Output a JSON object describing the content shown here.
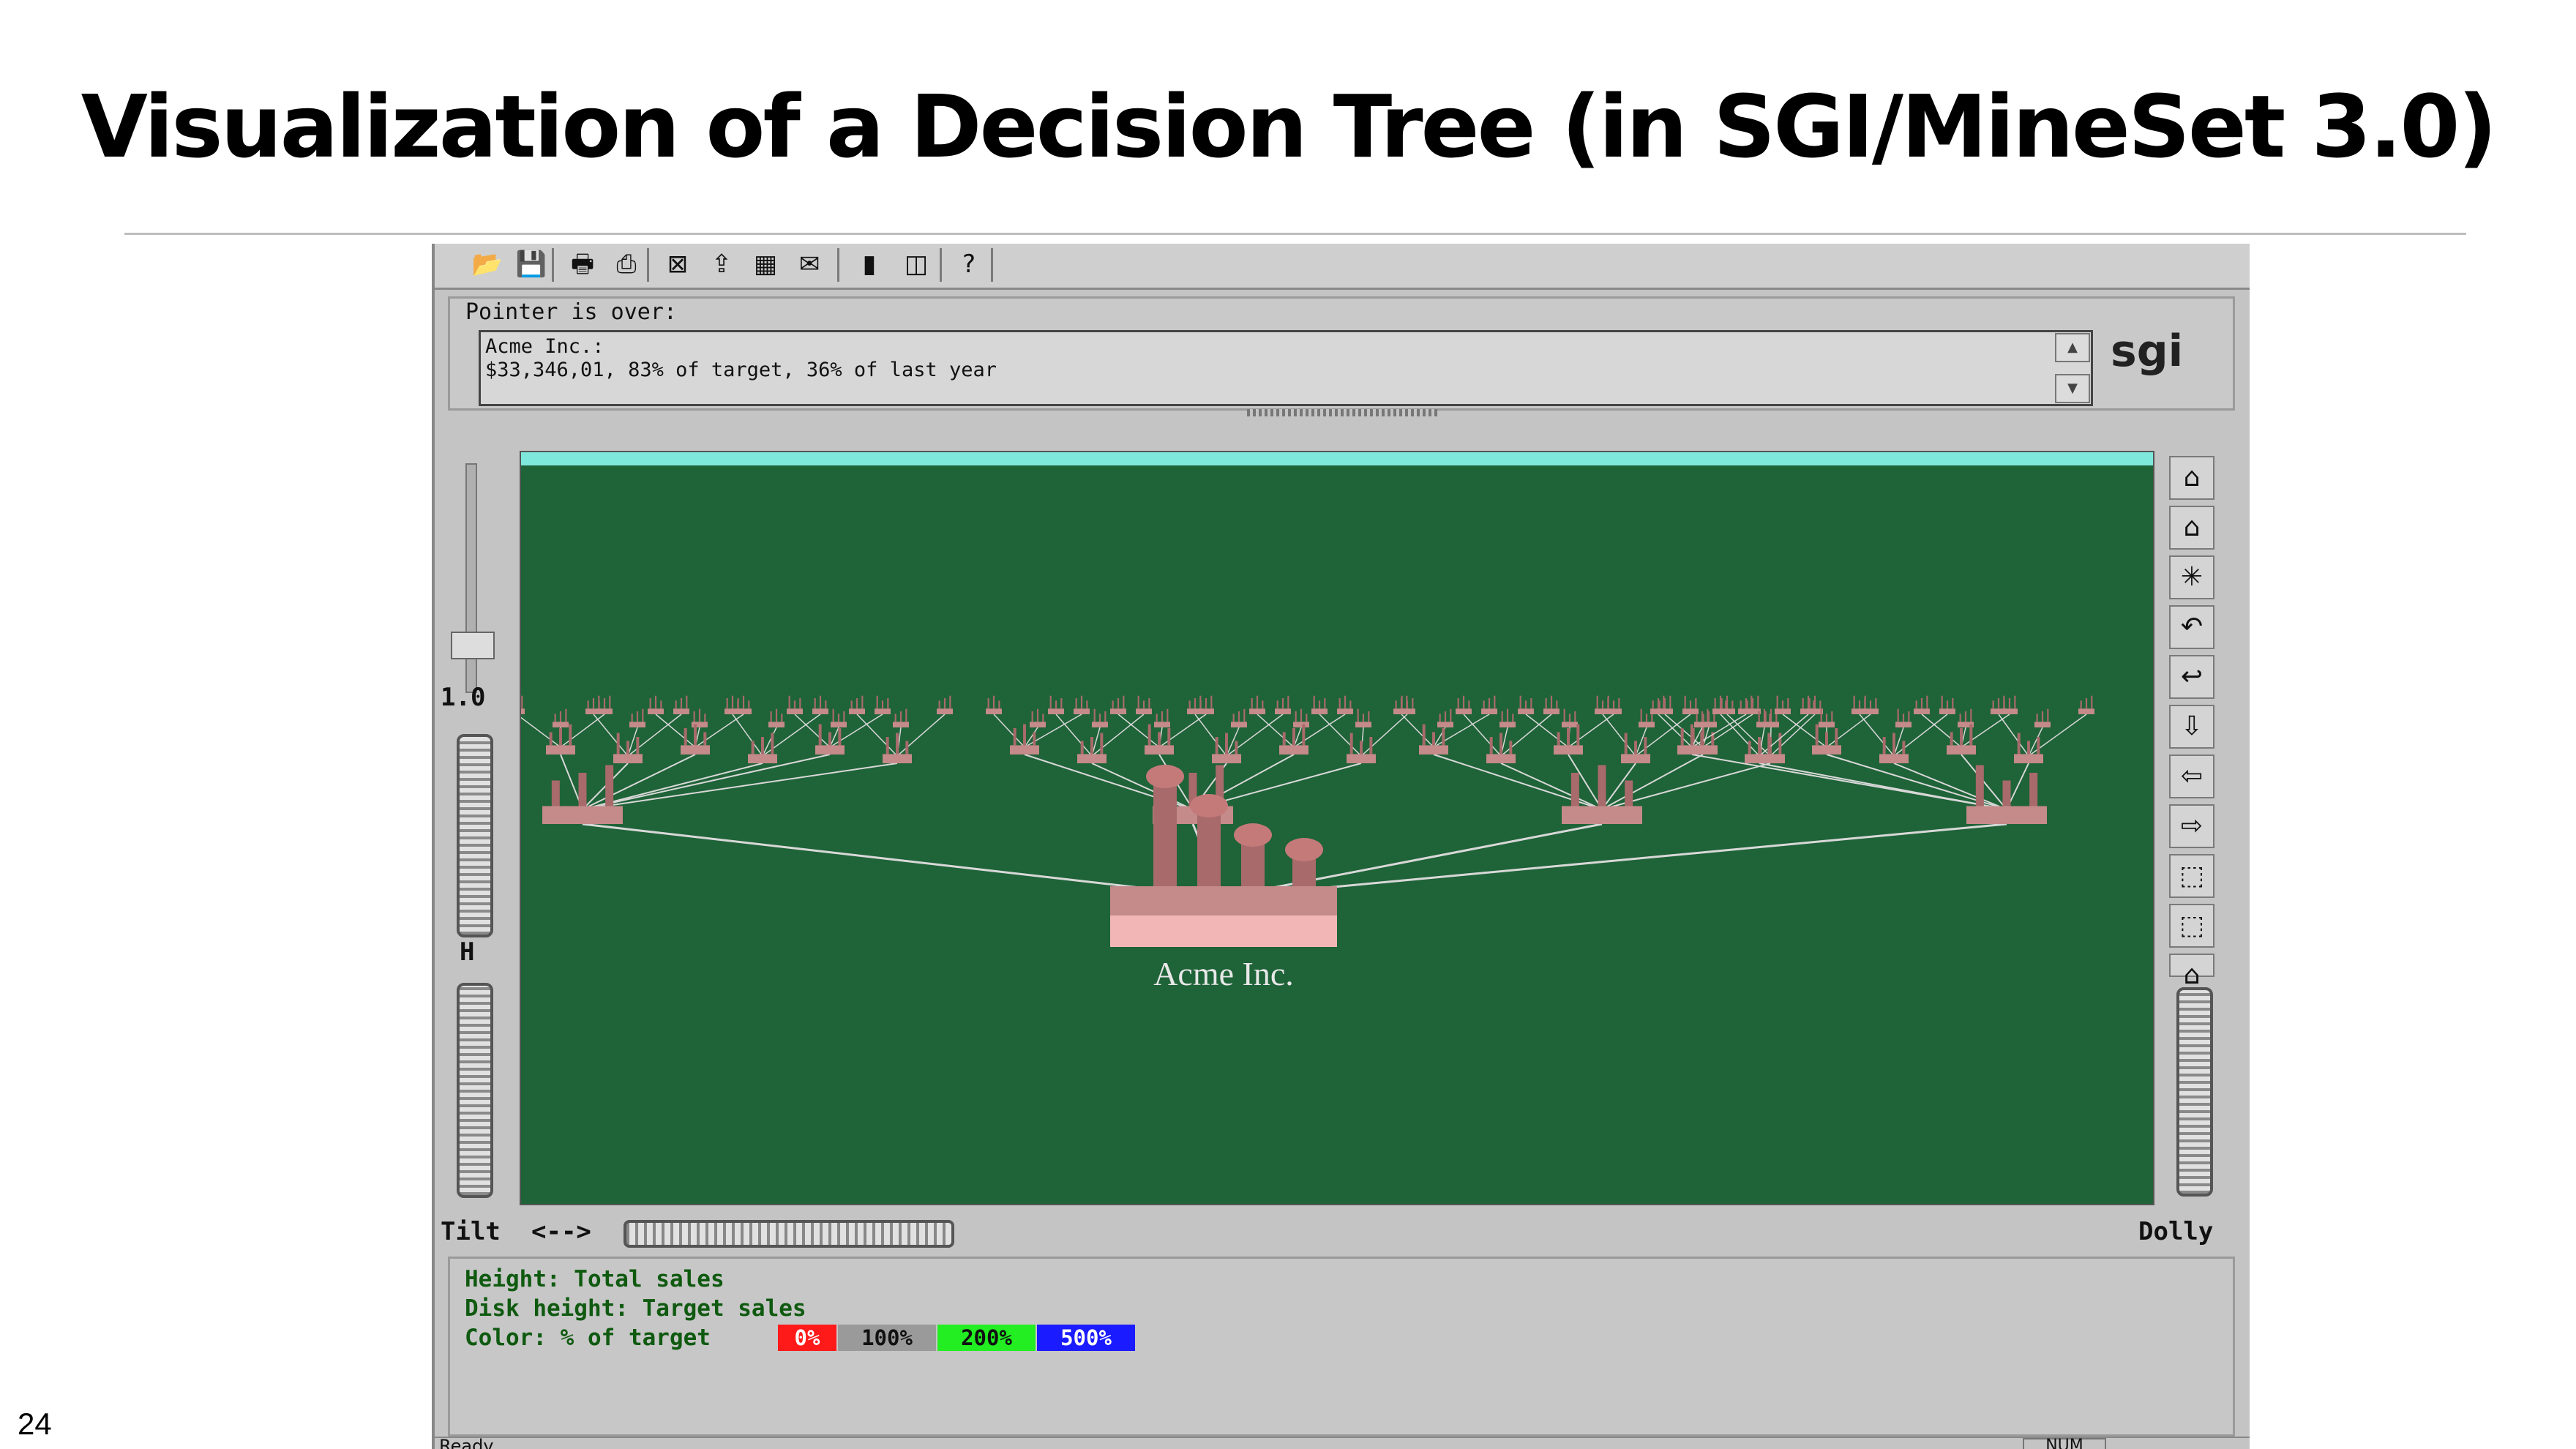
{
  "slide": {
    "title": "Visualization of a Decision Tree (in SGI/MineSet 3.0)",
    "number": "24"
  },
  "toolbar": {
    "buttons": [
      {
        "name": "open-icon",
        "glyph": "📂"
      },
      {
        "name": "save-icon",
        "glyph": "💾"
      },
      {
        "name": "print-icon",
        "glyph": "🖶"
      },
      {
        "name": "print-setup-icon",
        "glyph": "⎙"
      },
      {
        "name": "filter-icon",
        "glyph": "⊠"
      },
      {
        "name": "export-icon",
        "glyph": "⇪"
      },
      {
        "name": "table-icon",
        "glyph": "▦"
      },
      {
        "name": "send-icon",
        "glyph": "✉"
      },
      {
        "name": "chart-icon",
        "glyph": "▮"
      },
      {
        "name": "options-icon",
        "glyph": "◫"
      },
      {
        "name": "help-icon",
        "glyph": "?"
      }
    ]
  },
  "pointer": {
    "label": "Pointer is over:",
    "line1": "Acme Inc.:",
    "line2": "$33,346,01, 83% of target, 36% of last year",
    "logo": "sgi"
  },
  "viewer": {
    "root_label": "Acme Inc.",
    "tilt_value": "1.0",
    "h_label": "H",
    "tilt_label": "Tilt",
    "tilt_arrows": "<-->",
    "dolly_label": "Dolly",
    "side_buttons": [
      {
        "name": "home-icon",
        "glyph": "⌂"
      },
      {
        "name": "set-home-icon",
        "glyph": "⌂"
      },
      {
        "name": "view-all-icon",
        "glyph": "✳"
      },
      {
        "name": "undo-icon",
        "glyph": "↶"
      },
      {
        "name": "back-icon",
        "glyph": "↩"
      },
      {
        "name": "arrow-down-icon",
        "glyph": "⇩"
      },
      {
        "name": "arrow-left-icon",
        "glyph": "⇦"
      },
      {
        "name": "arrow-right-icon",
        "glyph": "⇨"
      },
      {
        "name": "seek-icon",
        "glyph": "⬚"
      },
      {
        "name": "pick-icon",
        "glyph": "⬚"
      },
      {
        "name": "more-icon",
        "glyph": "⌂"
      }
    ],
    "colors": {
      "background": "#1f6338",
      "edge": "#d8d8d8",
      "node": "#c58a8a",
      "base": "#f2b6b6"
    }
  },
  "legend": {
    "height_line": "Height: Total sales",
    "disk_line": "Disk height: Target sales",
    "color_line": "Color: % of target",
    "swatches": [
      {
        "label": "0%",
        "bg": "#ff1a1a",
        "fg": "#ffffff"
      },
      {
        "label": "100%",
        "bg": "#9a9a9a",
        "fg": "#111111"
      },
      {
        "label": "200%",
        "bg": "#22ee22",
        "fg": "#111111"
      },
      {
        "label": "500%",
        "bg": "#1b1bff",
        "fg": "#ffffff"
      }
    ]
  },
  "status": {
    "text": "Ready",
    "indicator": "NUM"
  }
}
